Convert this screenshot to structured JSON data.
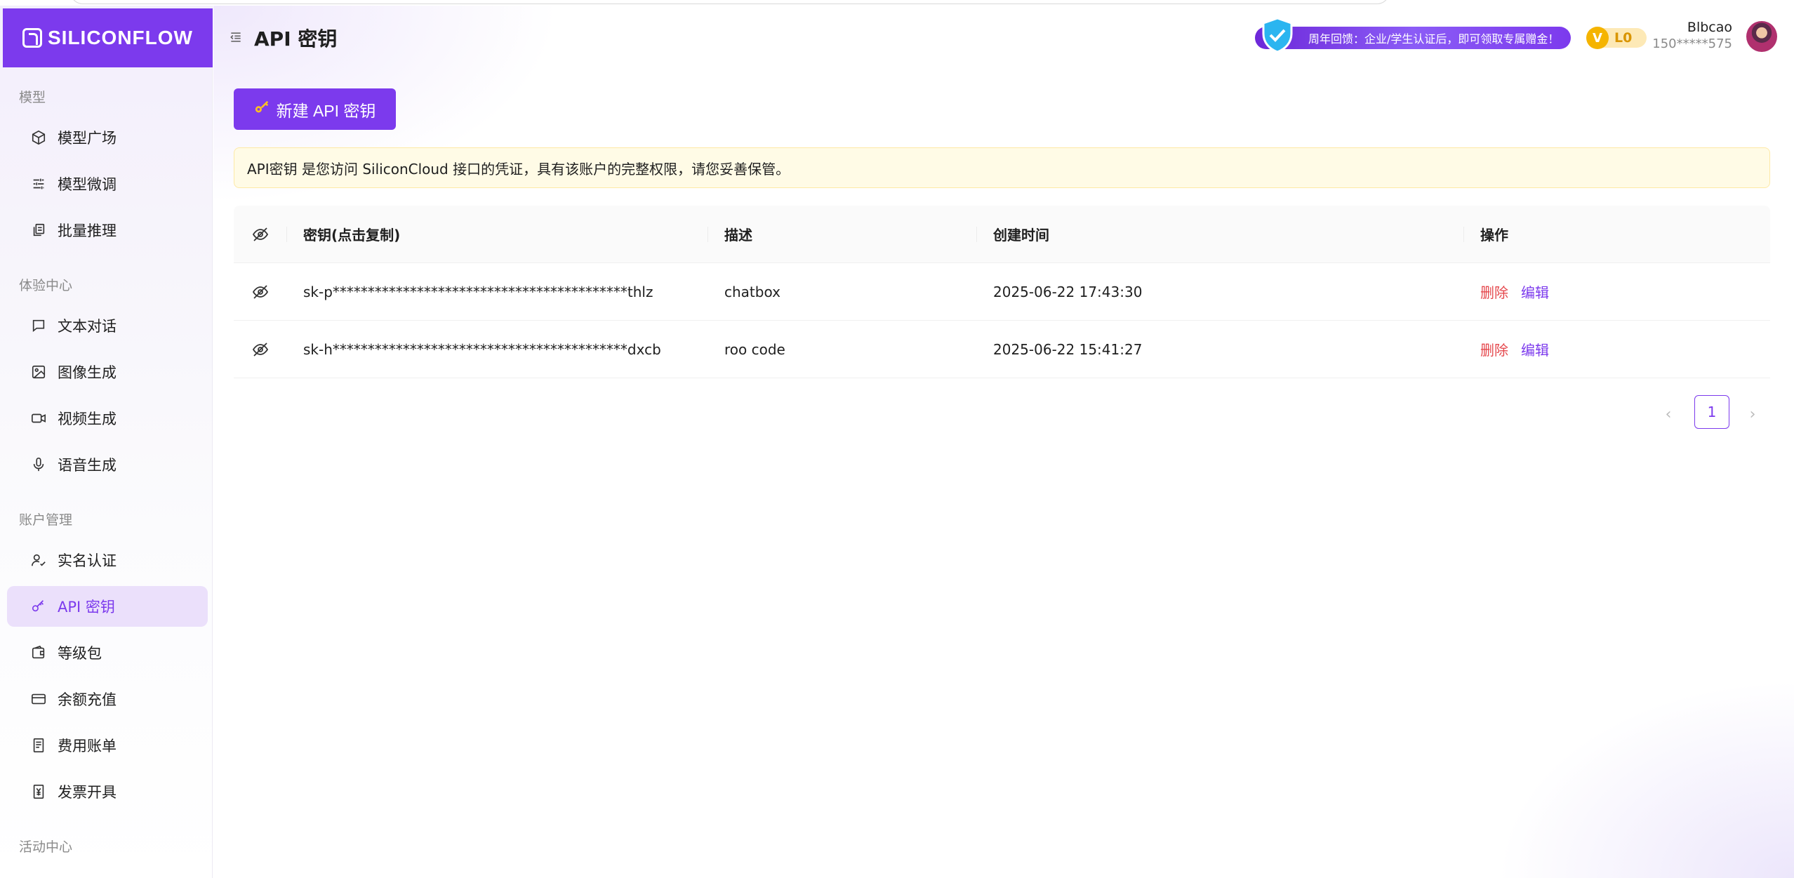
{
  "brand": {
    "logo_text": "SILICONFLOW",
    "accent": "#7c3aed"
  },
  "header": {
    "title": "API 密钥",
    "promo_text": "周年回馈：企业/学生认证后，即可领取专属赠金！",
    "level_badge": "L0",
    "level_letter": "V",
    "user_name": "Blbcao",
    "user_phone": "150*****575"
  },
  "sidebar": {
    "sections": [
      {
        "label": "模型"
      },
      {
        "label": "体验中心"
      },
      {
        "label": "账户管理"
      },
      {
        "label": "活动中心"
      }
    ],
    "items": [
      {
        "label": "模型广场",
        "icon": "cube-icon"
      },
      {
        "label": "模型微调",
        "icon": "sliders-icon"
      },
      {
        "label": "批量推理",
        "icon": "layers-icon"
      },
      {
        "label": "文本对话",
        "icon": "chat-icon"
      },
      {
        "label": "图像生成",
        "icon": "image-icon"
      },
      {
        "label": "视频生成",
        "icon": "video-icon"
      },
      {
        "label": "语音生成",
        "icon": "mic-icon"
      },
      {
        "label": "实名认证",
        "icon": "user-check-icon"
      },
      {
        "label": "API 密钥",
        "icon": "key-icon",
        "active": true
      },
      {
        "label": "等级包",
        "icon": "wallet-icon"
      },
      {
        "label": "余额充值",
        "icon": "card-icon"
      },
      {
        "label": "费用账单",
        "icon": "receipt-icon"
      },
      {
        "label": "发票开具",
        "icon": "invoice-icon"
      }
    ]
  },
  "main": {
    "new_button": "新建 API 密钥",
    "notice": "API密钥 是您访问 SiliconCloud 接口的凭证，具有该账户的完整权限，请您妥善保管。",
    "table": {
      "columns": [
        "密钥(点击复制)",
        "描述",
        "创建时间",
        "操作"
      ],
      "rows": [
        {
          "key": "sk-p******************************************thlz",
          "desc": "chatbox",
          "created": "2025-06-22 17:43:30",
          "del": "删除",
          "edit": "编辑"
        },
        {
          "key": "sk-h******************************************dxcb",
          "desc": "roo code",
          "created": "2025-06-22 15:41:27",
          "del": "删除",
          "edit": "编辑"
        }
      ]
    },
    "pagination": {
      "current_page": "1"
    }
  }
}
